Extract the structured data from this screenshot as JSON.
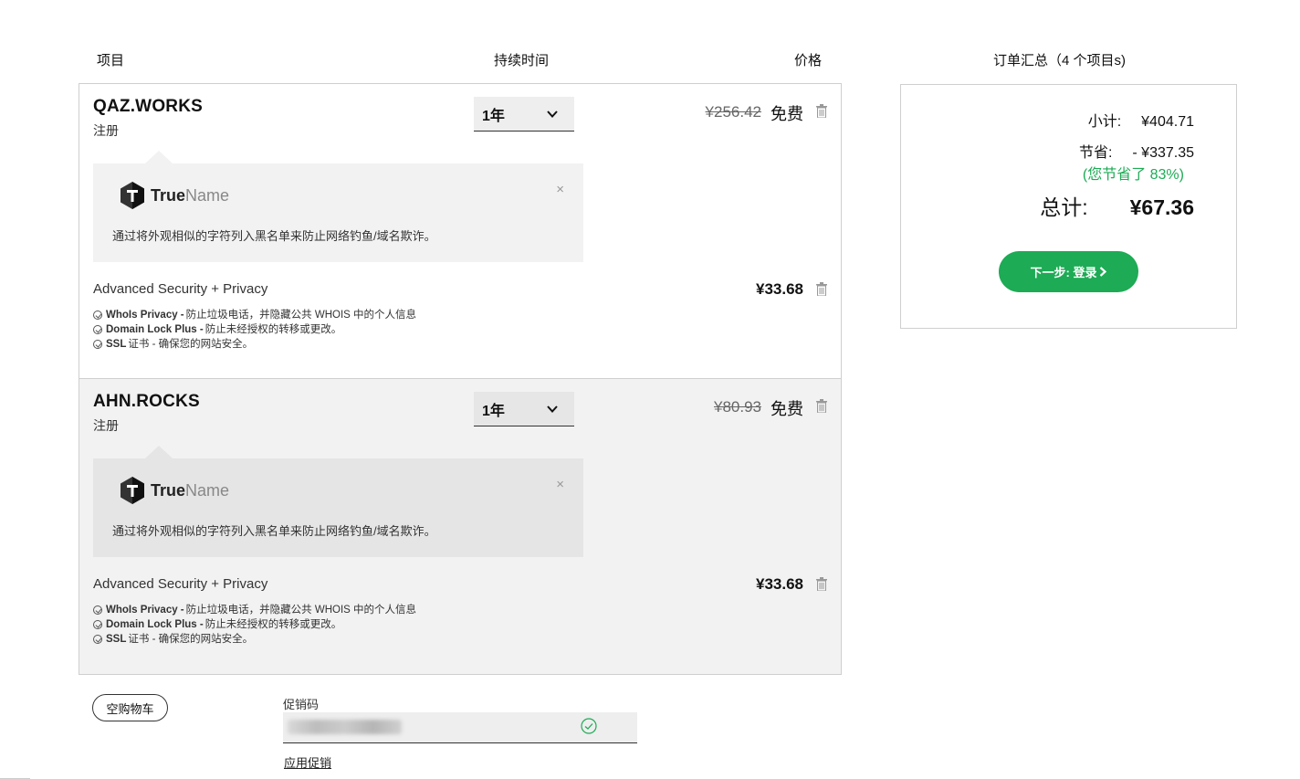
{
  "headers": {
    "item": "项目",
    "duration": "持续时间",
    "price": "价格",
    "summary": "订单汇总（4 个项目s)"
  },
  "items": [
    {
      "domain": "QAZ.WORKS",
      "type": "注册",
      "duration": "1年",
      "original_price": "¥256.42",
      "price": "免费",
      "truename": {
        "brand_bold": "True",
        "brand_light": "Name",
        "close": "×",
        "description": "通过将外观相似的字符列入黑名单来防止网络钓鱼/域名欺诈。"
      },
      "addon": {
        "title": "Advanced Security + Privacy",
        "price": "¥33.68",
        "features": [
          {
            "name": "WhoIs Privacy -",
            "desc": "防止垃圾电话，并隐藏公共 WHOIS 中的个人信息"
          },
          {
            "name": "Domain Lock Plus -",
            "desc": "防止未经授权的转移或更改。"
          },
          {
            "name": "SSL",
            "desc": "证书 - 确保您的网站安全。"
          }
        ]
      }
    },
    {
      "domain": "AHN.ROCKS",
      "type": "注册",
      "duration": "1年",
      "original_price": "¥80.93",
      "price": "免费",
      "truename": {
        "brand_bold": "True",
        "brand_light": "Name",
        "close": "×",
        "description": "通过将外观相似的字符列入黑名单来防止网络钓鱼/域名欺诈。"
      },
      "addon": {
        "title": "Advanced Security + Privacy",
        "price": "¥33.68",
        "features": [
          {
            "name": "WhoIs Privacy -",
            "desc": "防止垃圾电话，并隐藏公共 WHOIS 中的个人信息"
          },
          {
            "name": "Domain Lock Plus -",
            "desc": "防止未经授权的转移或更改。"
          },
          {
            "name": "SSL",
            "desc": "证书 - 确保您的网站安全。"
          }
        ]
      }
    }
  ],
  "cart_actions": {
    "empty_cart": "空购物车"
  },
  "promo": {
    "label": "促销码",
    "value": "",
    "apply": "应用促销"
  },
  "summary": {
    "subtotal_label": "小计:",
    "subtotal_value": "¥404.71",
    "savings_label": "节省:",
    "savings_value": "- ¥337.35",
    "savings_percent": "(您节省了 83%)",
    "total_label": "总计:",
    "total_value": "¥67.36",
    "next_button": "下一步: 登录"
  },
  "colors": {
    "accent_green": "#1dab55",
    "border": "#cfcfcf",
    "item_alt_bg": "#f2f2f2"
  }
}
